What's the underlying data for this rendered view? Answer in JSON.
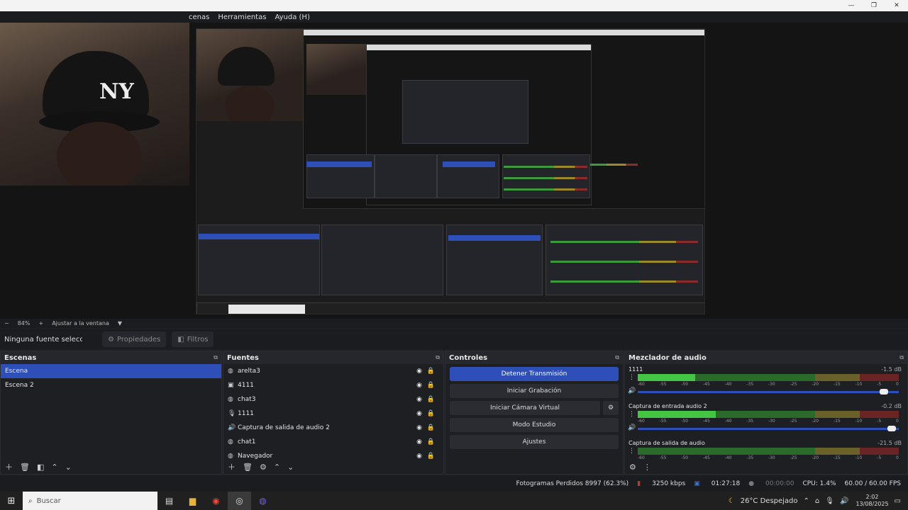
{
  "window": {
    "menu": [
      "cenas",
      "Herramientas",
      "Ayuda (H)"
    ],
    "controls": [
      "—",
      "❐",
      "✕"
    ]
  },
  "preview": {
    "zoom": "84%",
    "fit_label": "Ajustar a la ventana"
  },
  "source_toolbar": {
    "no_selection": "Ninguna fuente seleccionada",
    "properties": "Propiedades",
    "filters": "Filtros"
  },
  "scenes": {
    "title": "Escenas",
    "items": [
      "Escena",
      "Escena 2"
    ]
  },
  "sources": {
    "title": "Fuentes",
    "items": [
      {
        "icon": "globe-icon",
        "label": "arelta3"
      },
      {
        "icon": "camera-icon",
        "label": "4111"
      },
      {
        "icon": "globe-icon",
        "label": "chat3"
      },
      {
        "icon": "microphone-icon",
        "label": "1111"
      },
      {
        "icon": "speaker-icon",
        "label": "Captura de salida de audio 2"
      },
      {
        "icon": "globe-icon",
        "label": "chat1"
      },
      {
        "icon": "globe-icon",
        "label": "Navegador"
      }
    ]
  },
  "controls": {
    "title": "Controles",
    "stop_stream": "Detener Transmisión",
    "start_recording": "Iniciar Grabación",
    "start_virtual_cam": "Iniciar Cámara Virtual",
    "studio_mode": "Modo Estudio",
    "settings": "Ajustes"
  },
  "mixer": {
    "title": "Mezclador de audio",
    "ticks": [
      "-60",
      "-55",
      "-50",
      "-45",
      "-40",
      "-35",
      "-30",
      "-25",
      "-20",
      "-15",
      "-10",
      "-5",
      "0"
    ],
    "channels": [
      {
        "name": "1111",
        "db": "-1.5 dB",
        "level": 0.22,
        "volume": 0.96
      },
      {
        "name": "Captura de entrada audio 2",
        "db": "-0.2 dB",
        "level": 0.3,
        "volume": 0.99
      },
      {
        "name": "Captura de salida de audio",
        "db": "-21.5 dB",
        "level": 0.0,
        "volume": 0.9
      }
    ]
  },
  "status": {
    "dropped": "Fotogramas Perdidos 8997 (62.3%)",
    "bitrate": "3250 kbps",
    "stream_time": "01:27:18",
    "rec_time": "00:00:00",
    "cpu": "CPU: 1.4%",
    "fps": "60.00 / 60.00 FPS"
  },
  "taskbar": {
    "search": "Buscar",
    "weather": "26°C  Despejado",
    "time": "2:02",
    "date": "13/08/2025"
  },
  "colors": {
    "accent": "#2f4fb8",
    "meter_green": "#44c644",
    "meter_yellow": "#6a602a",
    "meter_red": "#6a2424"
  }
}
